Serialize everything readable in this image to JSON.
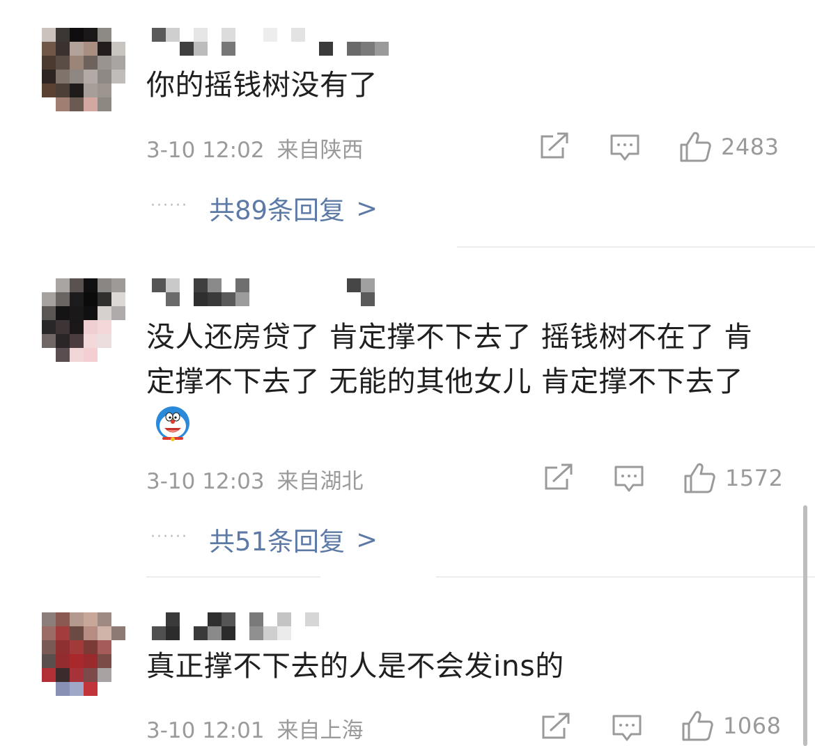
{
  "comments": [
    {
      "text": "你的摇钱树没有了",
      "date": "3-10 12:02",
      "location": "来自陕西",
      "likes": "2483",
      "replies": {
        "dots": "······",
        "label": "共89条回复",
        "arrow": ">"
      }
    },
    {
      "text": "没人还房贷了  肯定撑不下去了  摇钱树不在了  肯定撑不下去了  无能的其他女儿  肯定撑不下去了",
      "emoji": "doraemon-emoji",
      "date": "3-10 12:03",
      "location": "来自湖北",
      "likes": "1572",
      "replies": {
        "dots": "······",
        "label": "共51条回复",
        "arrow": ">"
      }
    },
    {
      "text": "真正撑不下去的人是不会发ins的",
      "date": "3-10 12:01",
      "location": "来自上海",
      "likes": "1068"
    }
  ],
  "icons": {
    "share": "share-icon",
    "comment": "comment-icon",
    "like": "thumbs-up-icon"
  },
  "colors": {
    "text": "#1f1f1f",
    "meta": "#9a9a9a",
    "reply_link": "#5d7aa6",
    "divider": "#ececec"
  }
}
